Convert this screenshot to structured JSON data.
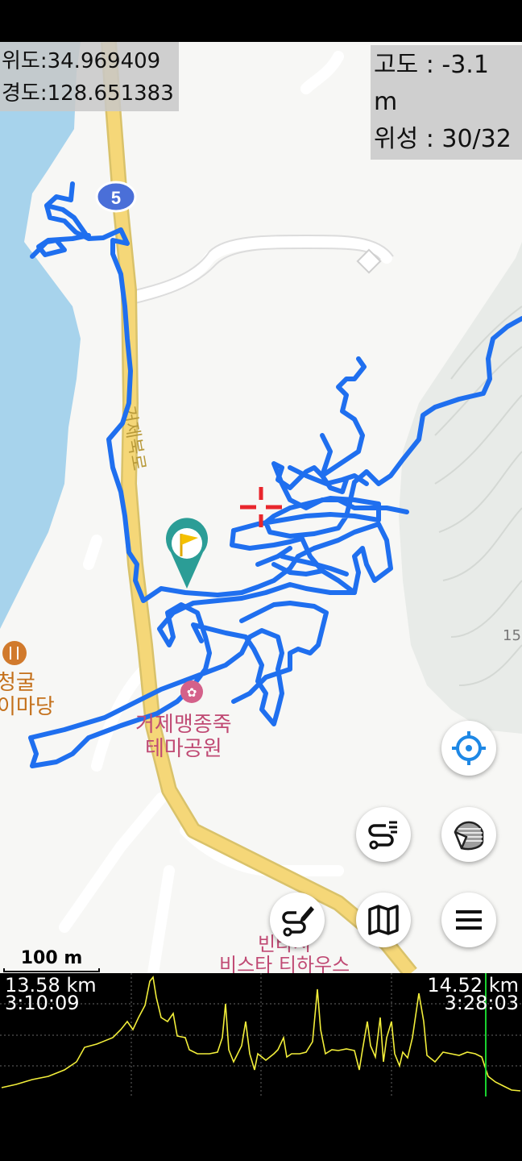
{
  "location": {
    "lat_label": "위도:34.969409",
    "lon_label": "경도:128.651383"
  },
  "status": {
    "altitude_label": "고도 : -3.1 m",
    "satellite_label": "위성 : 30/32"
  },
  "map": {
    "road_shield": "5",
    "road_name": "거제북로",
    "poi_park": [
      "거제맹종죽",
      "테마공원"
    ],
    "poi_restaurant": [
      "청굴",
      "이마당"
    ],
    "poi_bottom": [
      "빈타시",
      "비스타 티하우스"
    ],
    "contour_number": "15",
    "scale_label": "100 m",
    "colors": {
      "track": "#1f6fef",
      "road": "#f5d778",
      "water": "#a7d3ec",
      "marker": "#2b9d96"
    }
  },
  "controls": {
    "locate": "crosshair-icon",
    "layers": "layers-icon",
    "track_list": "track-list-icon",
    "edit_route": "edit-route-icon",
    "maps": "map-icon",
    "menu": "hamburger-icon"
  },
  "profile": {
    "start_distance": "13.58 km",
    "start_time": "3:10:09",
    "end_distance": "14.52 km",
    "end_time": "3:28:03",
    "line_color": "#f2ee3a",
    "cursor_color": "#19d12f",
    "cursor_fraction": 0.93
  }
}
